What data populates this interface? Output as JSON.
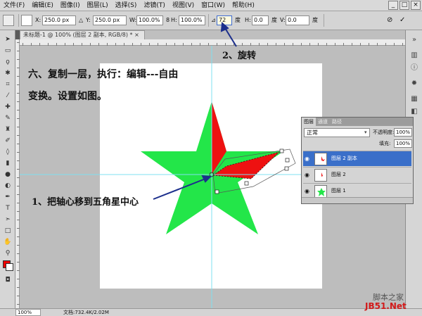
{
  "menu": [
    "文件(F)",
    "编辑(E)",
    "图像(I)",
    "图层(L)",
    "选择(S)",
    "滤镜(T)",
    "视图(V)",
    "窗口(W)",
    "帮助(H)"
  ],
  "window_controls": [
    "_",
    "□",
    "×"
  ],
  "options": {
    "x_label": "X:",
    "x_value": "250.0 px",
    "y_label": "Y:",
    "y_value": "250.0 px",
    "w_label": "W:",
    "w_value": "100.0%",
    "h_label": "H:",
    "h_value": "100.0%",
    "rotate_value": "72",
    "rotate_unit": "度",
    "hskew_label": "H:",
    "hskew_value": "0.0",
    "hskew_unit": "度",
    "vskew_label": "V:",
    "vskew_value": "0.0",
    "vskew_unit": "度"
  },
  "document_tab": "未标题-1 @ 100% (图层 2 副本, RGB/8) * ×",
  "annotations": {
    "instruction_line1": "六、复制一层，执行：编辑---自由",
    "instruction_line2": "变换。设置如图。",
    "step1": "1、把轴心移到五角星中心",
    "step2": "2、旋转"
  },
  "layers_panel": {
    "tabs": [
      "图层",
      "通道",
      "路径"
    ],
    "blend_mode": "正常",
    "opacity_label": "不透明度:",
    "opacity_value": "100%",
    "fill_label": "填充:",
    "fill_value": "100%",
    "layers": [
      {
        "name": "图层 2 副本",
        "selected": true
      },
      {
        "name": "图层 2",
        "selected": false
      },
      {
        "name": "图层 1",
        "selected": false
      }
    ]
  },
  "status": {
    "zoom": "100%",
    "doc_info": "文档:732.4K/2.02M"
  },
  "watermark": {
    "line1": "脚本之家",
    "line2": "JB51.Net"
  },
  "colors": {
    "star_green": "#23e649",
    "star_red": "#ee1111",
    "guide": "#7fe0f0",
    "selected_layer": "#3a6fc9",
    "arrow": "#1c2f8c"
  }
}
